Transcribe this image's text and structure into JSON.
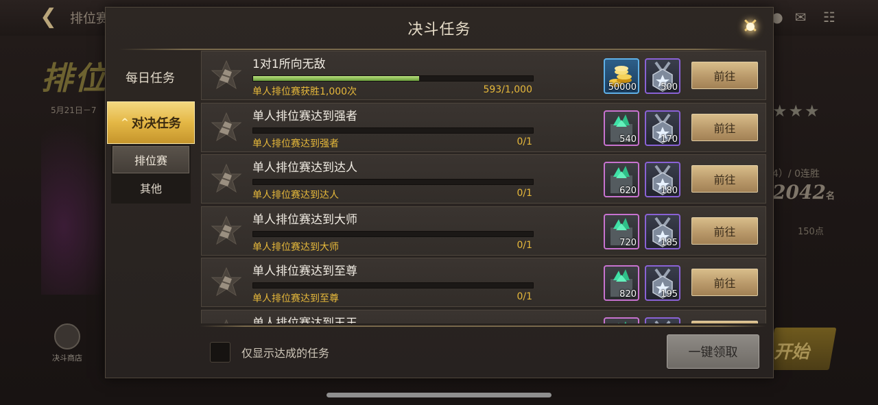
{
  "background": {
    "title": "排位赛",
    "date": "5月21日－7",
    "stars": "★★★",
    "record": "4）/ 0连胜",
    "score": "2042",
    "score_suffix": "名",
    "points": "150点",
    "start_label": "开始",
    "shop_label": "决斗商店"
  },
  "dialog": {
    "title": "决斗任务",
    "sidebar": {
      "daily_label": "每日任务",
      "duel_label": "对决任务",
      "sub_items": [
        "排位赛",
        "其他"
      ]
    },
    "tasks": [
      {
        "name": "1对1所向无敌",
        "desc": "单人排位赛获胜1,000次",
        "progress": "593/1,000",
        "progress_fraction": 0.593,
        "reward1": {
          "type": "gold",
          "qty": "50000"
        },
        "reward2": {
          "type": "medal",
          "qty": "500"
        },
        "button": "前往"
      },
      {
        "name": "单人排位赛达到强者",
        "desc": "单人排位赛达到强者",
        "progress": "0/1",
        "progress_fraction": 0,
        "reward1": {
          "type": "gem",
          "qty": "540"
        },
        "reward2": {
          "type": "medal",
          "qty": "170"
        },
        "button": "前往"
      },
      {
        "name": "单人排位赛达到达人",
        "desc": "单人排位赛达到达人",
        "progress": "0/1",
        "progress_fraction": 0,
        "reward1": {
          "type": "gem",
          "qty": "620"
        },
        "reward2": {
          "type": "medal",
          "qty": "180"
        },
        "button": "前往"
      },
      {
        "name": "单人排位赛达到大师",
        "desc": "单人排位赛达到大师",
        "progress": "0/1",
        "progress_fraction": 0,
        "reward1": {
          "type": "gem",
          "qty": "720"
        },
        "reward2": {
          "type": "medal",
          "qty": "185"
        },
        "button": "前往"
      },
      {
        "name": "单人排位赛达到至尊",
        "desc": "单人排位赛达到至尊",
        "progress": "0/1",
        "progress_fraction": 0,
        "reward1": {
          "type": "gem",
          "qty": "820"
        },
        "reward2": {
          "type": "medal",
          "qty": "195"
        },
        "button": "前往"
      },
      {
        "name": "单人排位赛达到王王",
        "desc": "",
        "progress": "",
        "progress_fraction": 0,
        "reward1": {
          "type": "gem",
          "qty": ""
        },
        "reward2": {
          "type": "medal",
          "qty": ""
        },
        "button": ""
      }
    ],
    "filter_label": "仅显示达成的任务",
    "claim_all_label": "一键领取"
  },
  "colors": {
    "accent_gold": "#e7b93b",
    "progress_green": "#8fcf52",
    "tab_active": "#e4b745"
  }
}
